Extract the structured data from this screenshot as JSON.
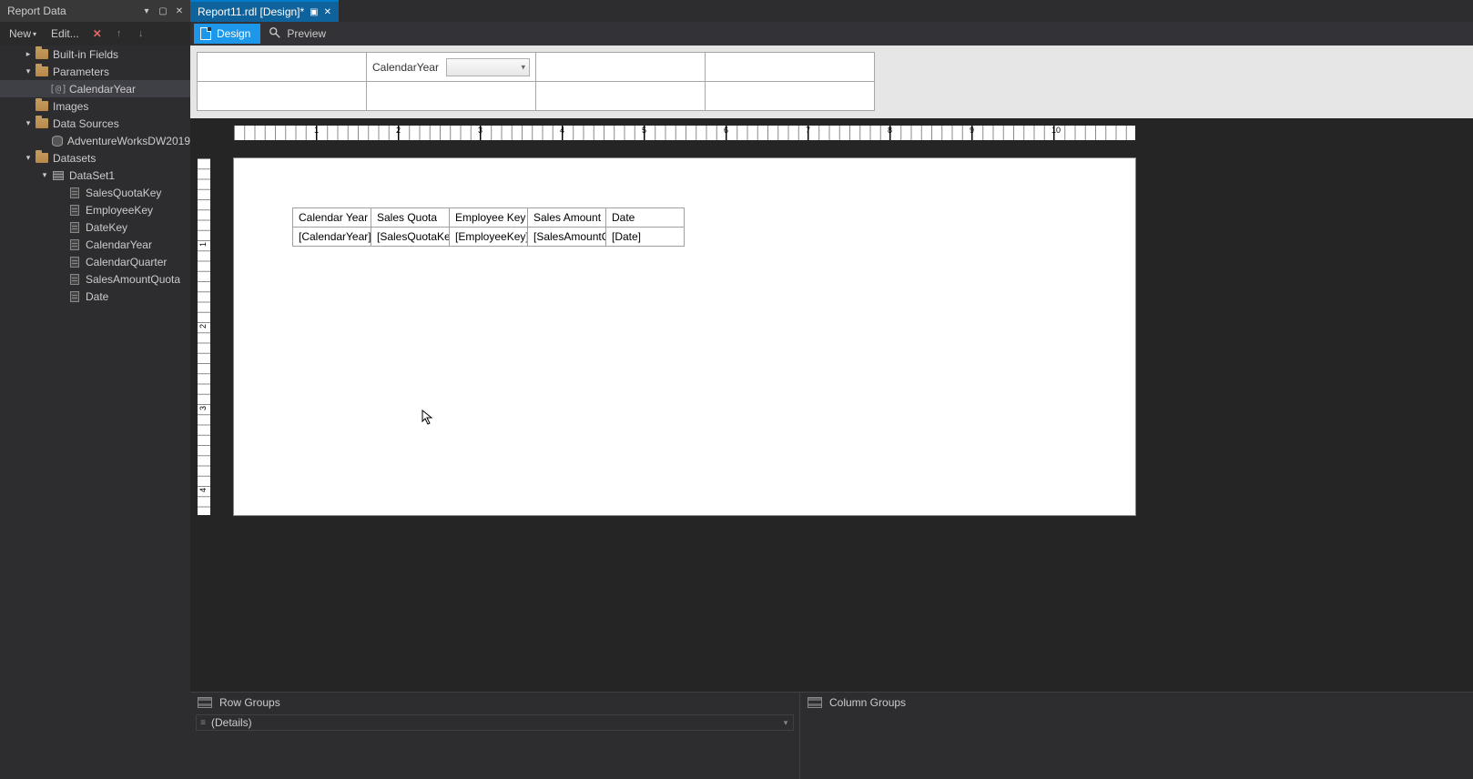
{
  "sidebar": {
    "title": "Report Data",
    "toolbar": {
      "new": "New",
      "edit": "Edit..."
    },
    "tree": [
      {
        "label": "Built-in Fields",
        "indent": 1,
        "twisty": "closed",
        "icon": "folder"
      },
      {
        "label": "Parameters",
        "indent": 1,
        "twisty": "open",
        "icon": "folder"
      },
      {
        "label": "CalendarYear",
        "indent": 2,
        "twisty": "none",
        "icon": "param",
        "selected": true
      },
      {
        "label": "Images",
        "indent": 1,
        "twisty": "none",
        "icon": "folder"
      },
      {
        "label": "Data Sources",
        "indent": 1,
        "twisty": "open",
        "icon": "folder"
      },
      {
        "label": "AdventureWorksDW2019",
        "indent": 2,
        "twisty": "none",
        "icon": "db"
      },
      {
        "label": "Datasets",
        "indent": 1,
        "twisty": "open",
        "icon": "folder"
      },
      {
        "label": "DataSet1",
        "indent": 2,
        "twisty": "open",
        "icon": "grid"
      },
      {
        "label": "SalesQuotaKey",
        "indent": 3,
        "twisty": "none",
        "icon": "field"
      },
      {
        "label": "EmployeeKey",
        "indent": 3,
        "twisty": "none",
        "icon": "field"
      },
      {
        "label": "DateKey",
        "indent": 3,
        "twisty": "none",
        "icon": "field"
      },
      {
        "label": "CalendarYear",
        "indent": 3,
        "twisty": "none",
        "icon": "field"
      },
      {
        "label": "CalendarQuarter",
        "indent": 3,
        "twisty": "none",
        "icon": "field"
      },
      {
        "label": "SalesAmountQuota",
        "indent": 3,
        "twisty": "none",
        "icon": "field"
      },
      {
        "label": "Date",
        "indent": 3,
        "twisty": "none",
        "icon": "field"
      }
    ]
  },
  "tab": {
    "title": "Report11.rdl [Design]*"
  },
  "views": {
    "design": "Design",
    "preview": "Preview"
  },
  "params": {
    "label": "CalendarYear"
  },
  "table": {
    "headers": [
      "Calendar Year",
      "Sales Quota",
      "Employee Key",
      "Sales Amount",
      "Date"
    ],
    "row": [
      "[CalendarYear]",
      "[SalesQuotaKey",
      "[EmployeeKey]",
      "[SalesAmountQ",
      "[Date]"
    ]
  },
  "groups": {
    "row_title": "Row Groups",
    "col_title": "Column Groups",
    "details": "(Details)"
  },
  "ruler_h": [
    "",
    "1",
    "2",
    "3",
    "4",
    "5",
    "6",
    "7",
    "8",
    "9",
    "10"
  ]
}
